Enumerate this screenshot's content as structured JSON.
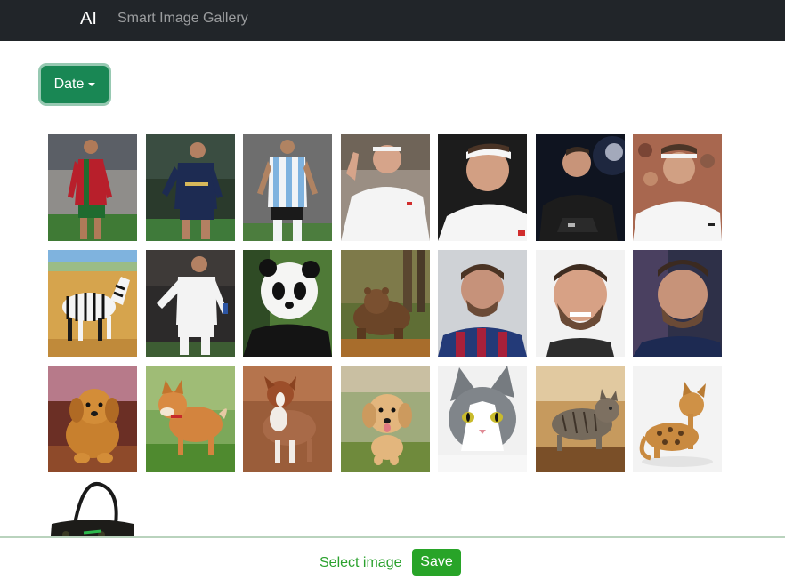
{
  "navbar": {
    "brand": "AI",
    "link": "Smart Image Gallery"
  },
  "filter": {
    "label": "Date"
  },
  "colors": {
    "navbar": "#212529",
    "accent": "#198754",
    "save": "#28a428"
  },
  "images": [
    {
      "name": "soccer-player-red-kit"
    },
    {
      "name": "soccer-player-navy-kit"
    },
    {
      "name": "soccer-player-striped-kit"
    },
    {
      "name": "tennis-player-white-shirt"
    },
    {
      "name": "tennis-player-headband-portrait"
    },
    {
      "name": "tennis-player-black-jacket"
    },
    {
      "name": "tennis-player-crowd"
    },
    {
      "name": "zebra"
    },
    {
      "name": "soccer-player-white-kit"
    },
    {
      "name": "panda"
    },
    {
      "name": "brown-bear"
    },
    {
      "name": "soccer-player-portrait-barcelona"
    },
    {
      "name": "soccer-player-smiling-portrait"
    },
    {
      "name": "soccer-player-looking-up"
    },
    {
      "name": "golden-retriever-puppy"
    },
    {
      "name": "shiba-inu-puppy"
    },
    {
      "name": "australian-shepherd"
    },
    {
      "name": "golden-puppy-running"
    },
    {
      "name": "grey-white-cat"
    },
    {
      "name": "tabby-cat-running"
    },
    {
      "name": "bengal-kitten"
    },
    {
      "name": "black-handbag"
    }
  ],
  "footer": {
    "select_text": "Select image",
    "save_label": "Save"
  }
}
